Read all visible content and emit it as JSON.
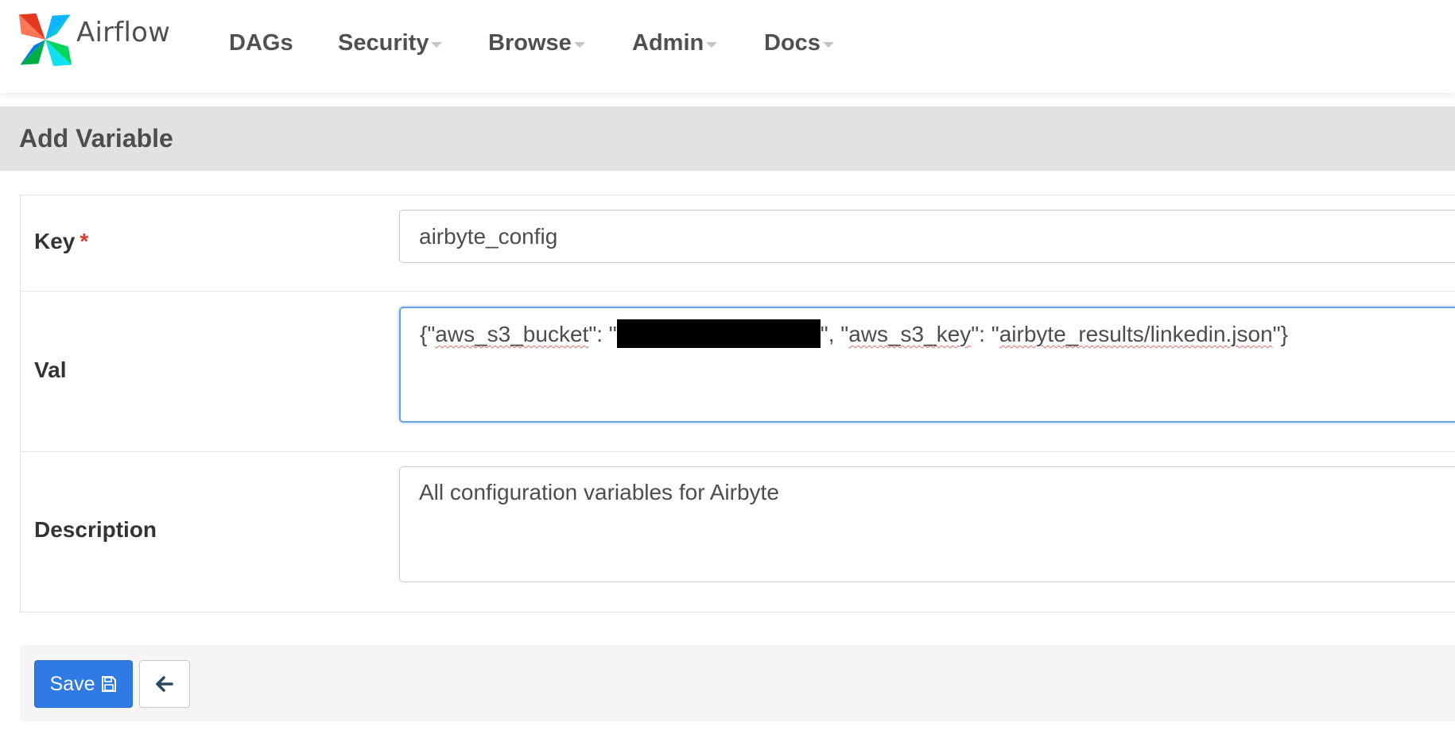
{
  "navbar": {
    "brand": "Airflow",
    "logo_icon": "airflow-pinwheel-icon",
    "items": [
      {
        "label": "DAGs",
        "dropdown": false
      },
      {
        "label": "Security",
        "dropdown": true
      },
      {
        "label": "Browse",
        "dropdown": true
      },
      {
        "label": "Admin",
        "dropdown": true
      },
      {
        "label": "Docs",
        "dropdown": true
      }
    ]
  },
  "page": {
    "title": "Add Variable"
  },
  "form": {
    "key": {
      "label": "Key",
      "required_marker": "*",
      "value": "airbyte_config"
    },
    "val": {
      "label": "Val",
      "value_parts": {
        "p1": "{\"",
        "p2": "aws_s3_bucket",
        "p3": "\": \"",
        "p4": "\", \"",
        "p5": "aws_s3_key",
        "p6": "\": \"",
        "p7": "airbyte_results/linkedin.json",
        "p8": "\"}"
      },
      "redacted": true
    },
    "description": {
      "label": "Description",
      "value": "All configuration variables for Airbyte"
    }
  },
  "actions": {
    "save_label": "Save",
    "save_icon": "floppy-disk-icon",
    "back_icon": "arrow-left-icon"
  },
  "colors": {
    "primary_button": "#2f7ae5",
    "heading_bg": "#e2e2e2",
    "focus_border": "#66a3e0",
    "required": "#e03b30"
  }
}
